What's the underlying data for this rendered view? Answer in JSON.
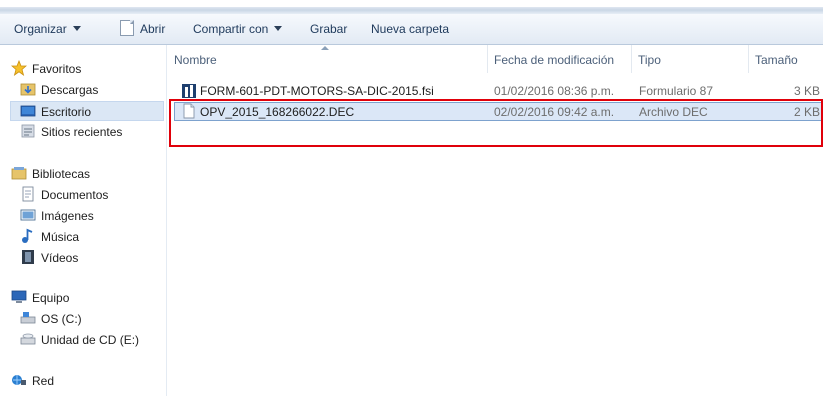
{
  "toolbar": {
    "organize": "Organizar",
    "open": "Abrir",
    "share": "Compartir con",
    "burn": "Grabar",
    "new_folder": "Nueva carpeta"
  },
  "nav": {
    "favorites": "Favoritos",
    "downloads": "Descargas",
    "desktop": "Escritorio",
    "recent": "Sitios recientes",
    "libraries": "Bibliotecas",
    "documents": "Documentos",
    "images": "Imágenes",
    "music": "Música",
    "videos": "Vídeos",
    "computer": "Equipo",
    "drive_c": "OS (C:)",
    "drive_e": "Unidad de CD (E:)",
    "network": "Red"
  },
  "columns": {
    "name": "Nombre",
    "date": "Fecha de modificación",
    "type": "Tipo",
    "size": "Tamaño"
  },
  "files": [
    {
      "name": "FORM-601-PDT-MOTORS-SA-DIC-2015.fsi",
      "date": "01/02/2016 08:36 p.m.",
      "type": "Formulario 87",
      "size": "3 KB",
      "icon": "form-app-icon"
    },
    {
      "name": "OPV_2015_168266022.DEC",
      "date": "02/02/2016 09:42 a.m.",
      "type": "Archivo DEC",
      "size": "2 KB",
      "icon": "blank-document-icon"
    }
  ],
  "colors": {
    "selection": "#dbe7f7",
    "highlight_box": "#e0000a"
  }
}
